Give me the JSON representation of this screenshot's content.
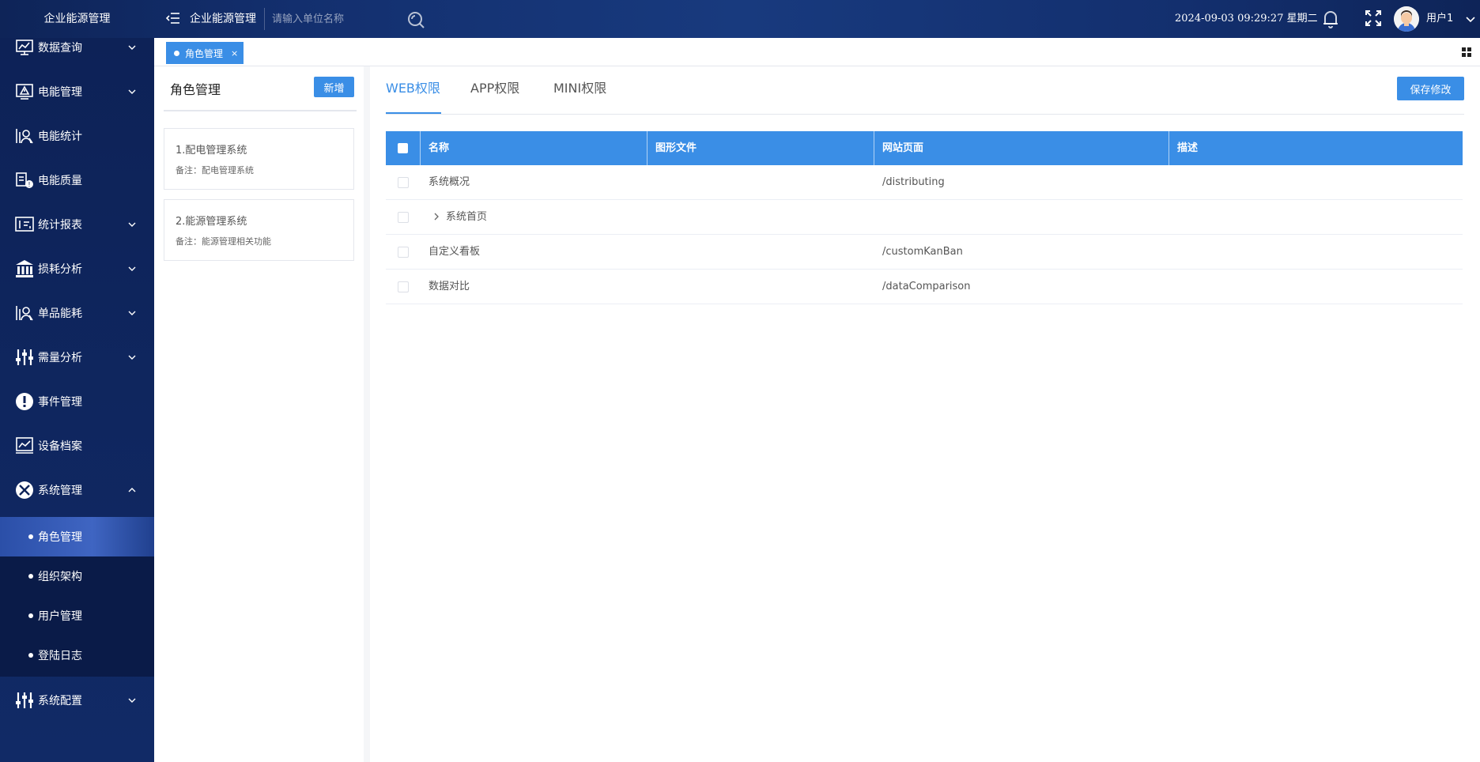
{
  "header": {
    "brand": "企业能源管理",
    "title": "企业能源管理",
    "search_placeholder": "请输入单位名称",
    "datetime": "2024-09-03 09:29:27 星期二",
    "username": "用户1"
  },
  "sidebar": {
    "items": [
      {
        "label": "数据查询",
        "icon": "monitor-chart-icon",
        "has_caret": true
      },
      {
        "label": "电能管理",
        "icon": "warning-monitor-icon",
        "has_caret": true
      },
      {
        "label": "电能统计",
        "icon": "stats-icon",
        "has_caret": false
      },
      {
        "label": "电能质量",
        "icon": "quality-icon",
        "has_caret": false
      },
      {
        "label": "统计报表",
        "icon": "report-icon",
        "has_caret": true
      },
      {
        "label": "损耗分析",
        "icon": "bank-icon",
        "has_caret": true
      },
      {
        "label": "单品能耗",
        "icon": "product-stats-icon",
        "has_caret": true
      },
      {
        "label": "需量分析",
        "icon": "sliders-icon",
        "has_caret": true
      },
      {
        "label": "事件管理",
        "icon": "alert-icon",
        "has_caret": false
      },
      {
        "label": "设备档案",
        "icon": "device-icon",
        "has_caret": false
      },
      {
        "label": "系统管理",
        "icon": "tools-icon",
        "has_caret": true,
        "expanded": true
      },
      {
        "label": "系统配置",
        "icon": "config-sliders-icon",
        "has_caret": true
      }
    ],
    "submenu": [
      {
        "label": "角色管理",
        "active": true
      },
      {
        "label": "组织架构"
      },
      {
        "label": "用户管理"
      },
      {
        "label": "登陆日志"
      }
    ]
  },
  "tabs": {
    "active_tab": "角色管理",
    "close_symbol": "×"
  },
  "roles_panel": {
    "title": "角色管理",
    "add_label": "新增",
    "roles": [
      {
        "name": "1.配电管理系统",
        "note": "备注：配电管理系统"
      },
      {
        "name": "2.能源管理系统",
        "note": "备注：能源管理相关功能"
      }
    ]
  },
  "permissions": {
    "tabs": [
      "WEB权限",
      "APP权限",
      "MINI权限"
    ],
    "active_tab": "WEB权限",
    "save_label": "保存修改",
    "columns": [
      "名称",
      "图形文件",
      "网站页面",
      "描述"
    ],
    "rows": [
      {
        "name": "系统概况",
        "file": "",
        "page": "/distributing",
        "desc": "",
        "expandable": false
      },
      {
        "name": "系统首页",
        "file": "",
        "page": "",
        "desc": "",
        "expandable": true
      },
      {
        "name": "自定义看板",
        "file": "",
        "page": "/customKanBan",
        "desc": "",
        "expandable": false
      },
      {
        "name": "数据对比",
        "file": "",
        "page": "/dataComparison",
        "desc": "",
        "expandable": false
      }
    ]
  },
  "colors": {
    "accent": "#3a8ee6",
    "sidebar_bg": "#0d2257",
    "header_bg": "#132f6e"
  }
}
